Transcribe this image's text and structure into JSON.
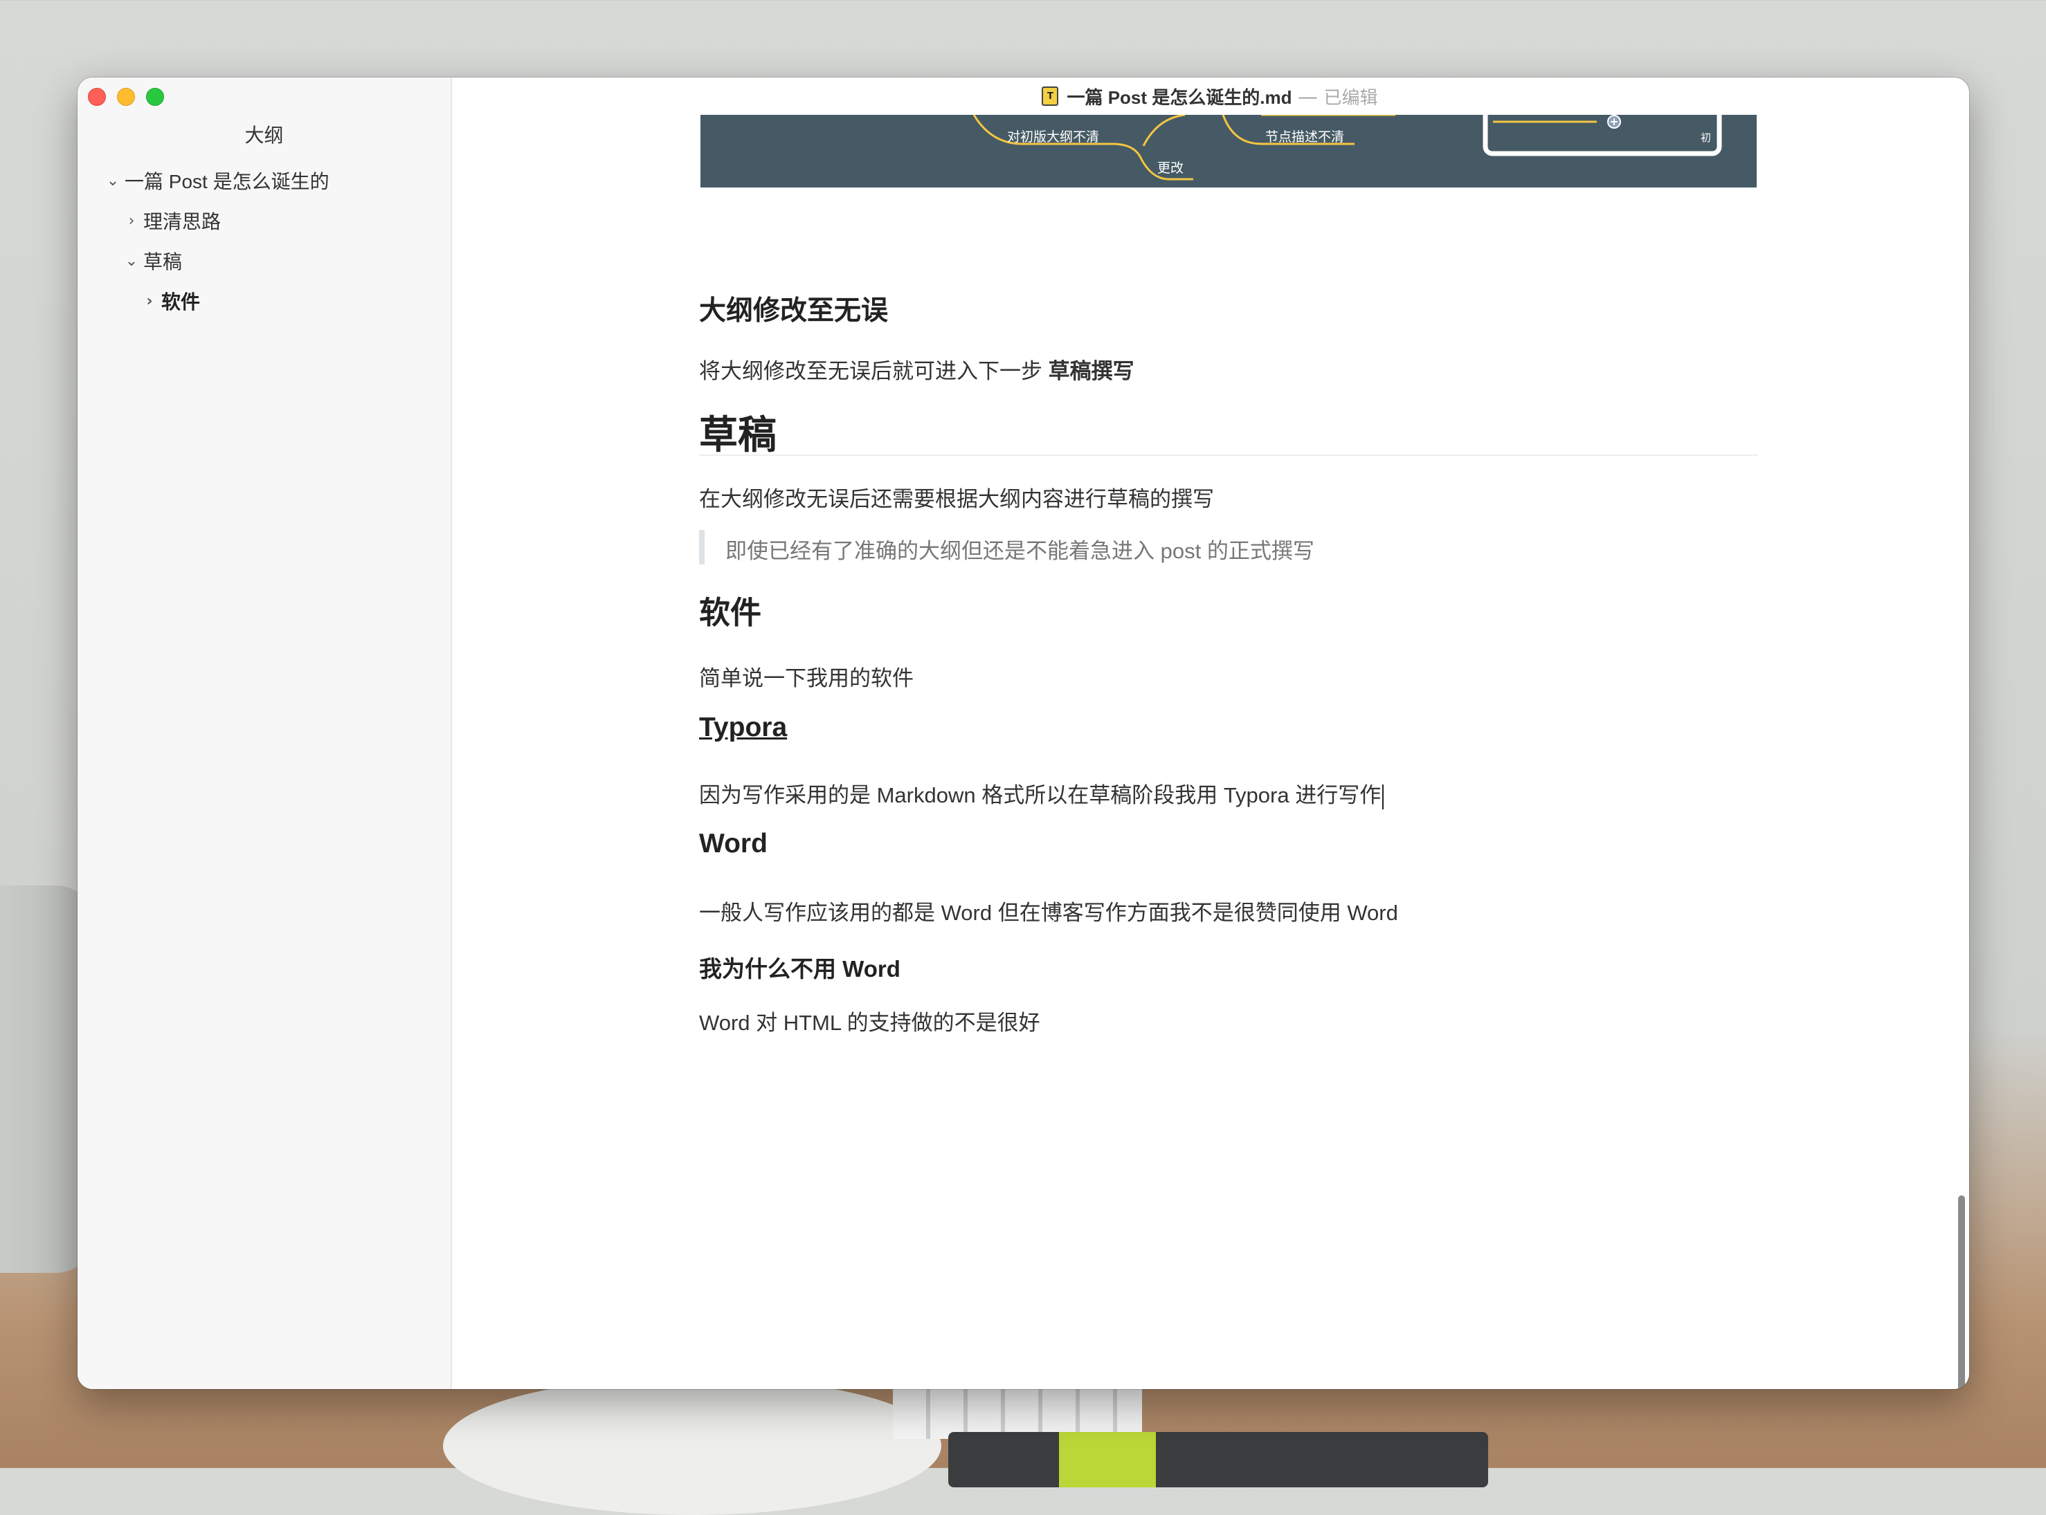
{
  "window": {
    "title": "一篇 Post 是怎么诞生的.md",
    "separator": "—",
    "status": "已编辑",
    "doc_icon": "T"
  },
  "sidebar": {
    "title": "大纲",
    "items": [
      {
        "label": "一篇 Post 是怎么诞生的",
        "chevron": "⌄",
        "state": "expanded",
        "level": 1
      },
      {
        "label": "理清思路",
        "chevron": "›",
        "state": "collapsed",
        "level": 2
      },
      {
        "label": "草稿",
        "chevron": "⌄",
        "state": "expanded",
        "level": 2
      },
      {
        "label": "软件",
        "chevron": "›",
        "state": "collapsed",
        "level": 3,
        "active": true
      }
    ]
  },
  "mindmap": {
    "background": "#455a64",
    "line_color": "#f4c542",
    "labels": [
      "对初版大纲不清",
      "节点描述不清",
      "更改",
      "初"
    ]
  },
  "document": {
    "h_outline_fix": "大纲修改至无误",
    "p_outline_fix_prefix": "将大纲修改至无误后就可进入下一步 ",
    "p_outline_fix_bold": "草稿撰写",
    "h_draft": "草稿",
    "p_draft": "在大纲修改无误后还需要根据大纲内容进行草稿的撰写",
    "quote_draft": "即使已经有了准确的大纲但还是不能着急进入 post 的正式撰写",
    "h_software": "软件",
    "p_software": "简单说一下我用的软件",
    "h_typora": "Typora",
    "p_typora": "因为写作采用的是 Markdown 格式所以在草稿阶段我用 Typora 进行写作",
    "h_word": "Word",
    "p_word": "一般人写作应该用的都是 Word 但在博客写作方面我不是很赞同使用 Word",
    "h_why_not_word": "我为什么不用 Word",
    "p_why_not_word": "Word 对 HTML 的支持做的不是很好"
  },
  "colors": {
    "link": "#4183c4",
    "close": "#fe5f57",
    "minimize": "#febc2e",
    "maximize": "#28c840"
  }
}
